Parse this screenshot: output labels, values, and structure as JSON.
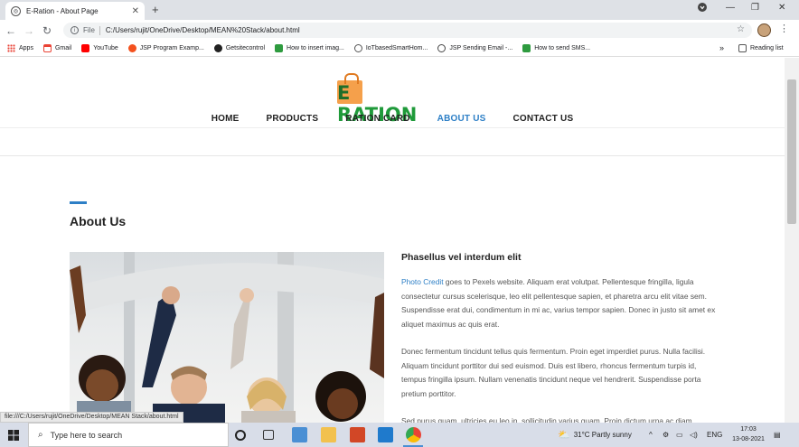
{
  "browser": {
    "tab_title": "E-Ration - About Page",
    "tab_close": "✕",
    "new_tab": "+",
    "window_controls": [
      "—",
      "❐",
      "✕"
    ],
    "url_prefix": "File",
    "url": "C:/Users/rujit/OneDrive/Desktop/MEAN%20Stack/about.html",
    "bookmarks": [
      "Apps",
      "Gmail",
      "YouTube",
      "JSP Program Examp...",
      "Getsitecontrol",
      "How to insert imag...",
      "IoTbasedSmartHom...",
      "JSP Sending Email -...",
      "How to send SMS..."
    ],
    "bookmarks_more": "»",
    "reading_list": "Reading list",
    "status_url": "file:///C:/Users/rujit/OneDrive/Desktop/MEAN Stack/about.html"
  },
  "site": {
    "logo_text_e": "E",
    "logo_text_rest": " RATION",
    "nav": [
      "HOME",
      "PRODUCTS",
      "RATION CARD",
      "ABOUT US",
      "CONTACT US"
    ],
    "active_nav": "ABOUT US",
    "section_title": "About Us",
    "subheading": "Phasellus vel interdum elit",
    "photo_credit_link": "Photo Credit",
    "para1_rest": " goes to Pexels website. Aliquam erat volutpat. Pellentesque fringilla, ligula consectetur cursus scelerisque, leo elit pellentesque sapien, et pharetra arcu elit vitae sem. Suspendisse erat dui, condimentum in mi ac, varius tempor sapien. Donec in justo sit amet ex aliquet maximus ac quis erat.",
    "para2": "Donec fermentum tincidunt tellus quis fermentum. Proin eget imperdiet purus. Nulla facilisi. Aliquam tincidunt porttitor dui sed euismod. Duis est libero, rhoncus fermentum turpis id, tempus fringilla ipsum. Nullam venenatis tincidunt neque vel hendrerit. Suspendisse porta pretium porttitor.",
    "para3": "Sed purus quam, ultricies eu leo in, sollicitudin varius quam. Proin dictum urna ac diam"
  },
  "taskbar": {
    "search_placeholder": "Type here to search",
    "weather": "31°C  Partly sunny",
    "lang": "ENG",
    "time": "17:03",
    "date": "13-08-2021"
  },
  "colors": {
    "accent": "#2d7fc6",
    "logo_green": "#1f9a3a",
    "logo_orange": "#f5a04b"
  }
}
